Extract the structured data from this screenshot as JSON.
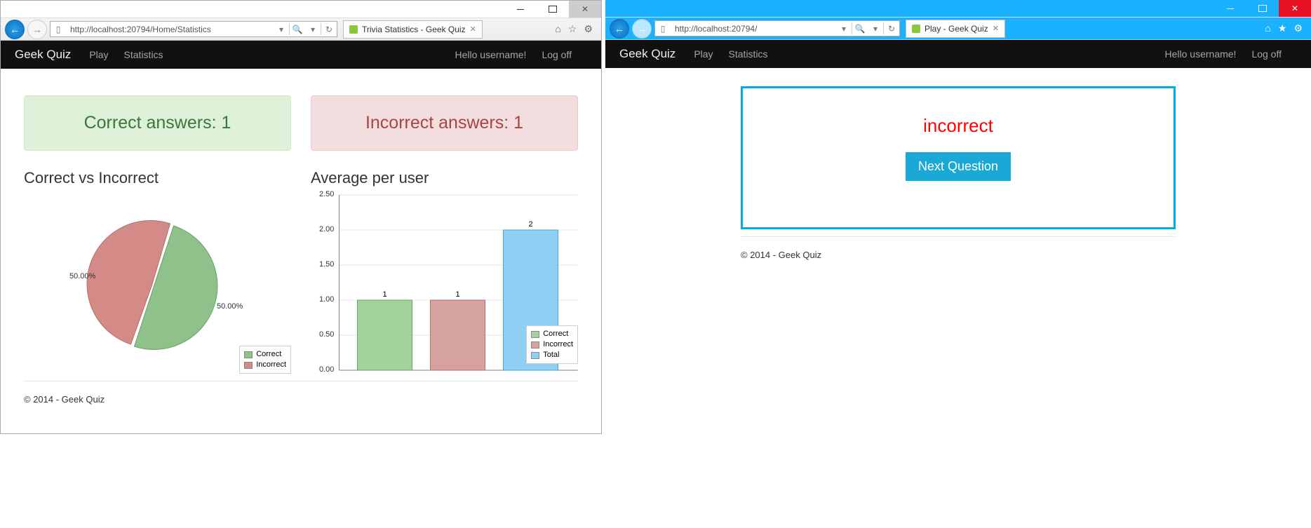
{
  "left_window": {
    "address": "http://localhost:20794/Home/Statistics",
    "tab_title": "Trivia Statistics - Geek Quiz"
  },
  "right_window": {
    "address": "http://localhost:20794/",
    "tab_title": "Play - Geek Quiz"
  },
  "nav": {
    "brand": "Geek Quiz",
    "play": "Play",
    "stats": "Statistics",
    "hello": "Hello username!",
    "logoff": "Log off"
  },
  "statistics": {
    "correct_label": "Correct answers: 1",
    "incorrect_label": "Incorrect answers: 1",
    "pie_title": "Correct vs Incorrect",
    "bar_title": "Average per user",
    "pie": {
      "left_pct": "50.00%",
      "right_pct": "50.00%",
      "legend_correct": "Correct",
      "legend_incorrect": "Incorrect"
    },
    "bar": {
      "labels": {
        "correct": "Correct",
        "incorrect": "Incorrect",
        "total": "Total"
      },
      "val_correct": "1",
      "val_incorrect": "1",
      "val_total": "2",
      "ticks": {
        "t0": "0.00",
        "t05": "0.50",
        "t1": "1.00",
        "t15": "1.50",
        "t2": "2.00",
        "t25": "2.50"
      }
    }
  },
  "footer": "© 2014 - Geek Quiz",
  "play": {
    "result": "incorrect",
    "next_btn": "Next Question"
  },
  "chart_data": [
    {
      "type": "pie",
      "title": "Correct vs Incorrect",
      "series": [
        {
          "name": "Correct",
          "value": 50.0,
          "color": "#8fc18b"
        },
        {
          "name": "Incorrect",
          "value": 50.0,
          "color": "#d48b87"
        }
      ]
    },
    {
      "type": "bar",
      "title": "Average per user",
      "categories": [
        "Correct",
        "Incorrect",
        "Total"
      ],
      "values": [
        1,
        1,
        2
      ],
      "series_colors": [
        "#a3d39c",
        "#d6a2a0",
        "#8fcff3"
      ],
      "ylim": [
        0,
        2.5
      ],
      "ylabel": "",
      "xlabel": ""
    }
  ]
}
